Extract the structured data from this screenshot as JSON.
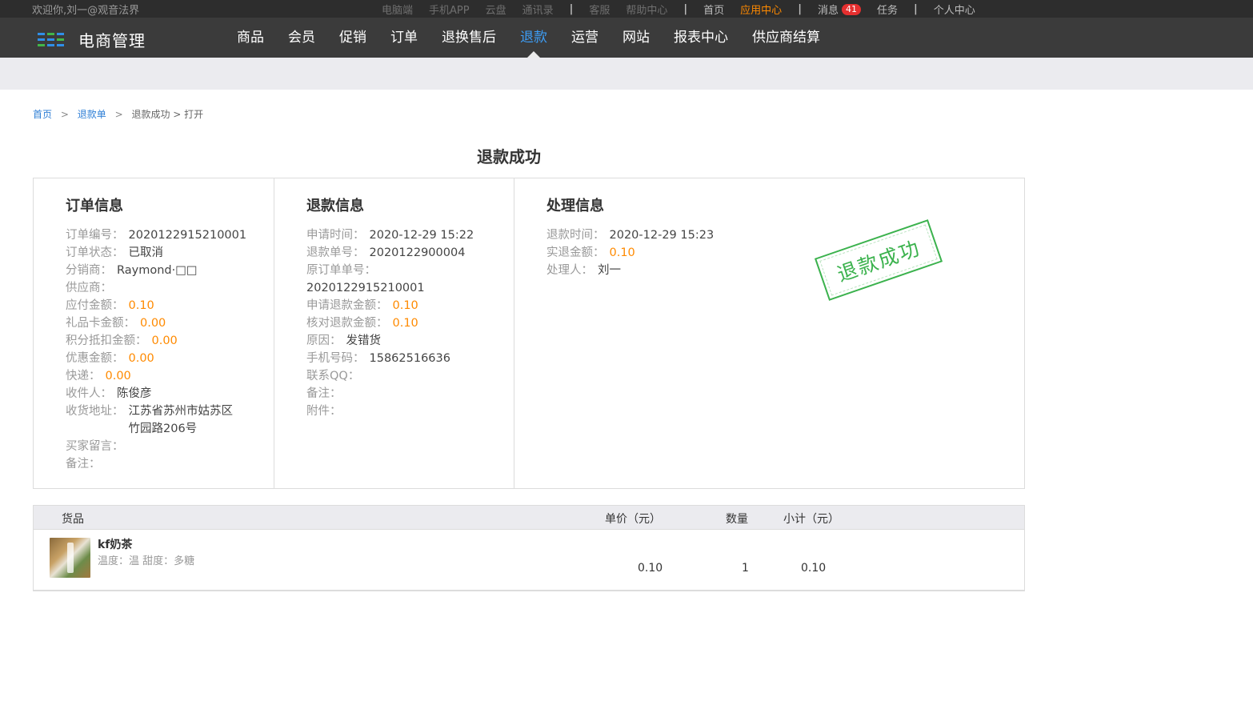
{
  "topbar": {
    "welcome": "欢迎你,刘一@观音法界",
    "links_dim": [
      "电脑端",
      "手机APP",
      "云盘",
      "通讯录"
    ],
    "links_mid": [
      "客服",
      "帮助中心"
    ],
    "separator": "|",
    "home": "首页",
    "app_center": "应用中心",
    "messages": "消息",
    "messages_count": "41",
    "tasks": "任务",
    "personal": "个人中心"
  },
  "nav": {
    "logo_text": "电商管理",
    "items": [
      "商品",
      "会员",
      "促销",
      "订单",
      "退换售后",
      "退款",
      "运营",
      "网站",
      "报表中心",
      "供应商结算"
    ],
    "active_index": 5
  },
  "breadcrumb": {
    "home": "首页",
    "refund_list": "退款单",
    "current": "退款成功 > 打开",
    "separator": ">"
  },
  "page_title": "退款成功",
  "order_info": {
    "title": "订单信息",
    "order_no_label": "订单编号：",
    "order_no": "2020122915210001",
    "status_label": "订单状态：",
    "status": "已取消",
    "distributor_label": "分销商：",
    "distributor": "Raymond·□□",
    "supplier_label": "供应商：",
    "payable_label": "应付金额：",
    "payable": "0.10",
    "giftcard_label": "礼品卡金额：",
    "giftcard": "0.00",
    "points_label": "积分抵扣金额：",
    "points": "0.00",
    "discount_label": "优惠金额：",
    "discount": "0.00",
    "express_label": "快递：",
    "express": "0.00",
    "receiver_label": "收件人：",
    "receiver": "陈俊彦",
    "address_label": "收货地址：",
    "address": "江苏省苏州市姑苏区竹园路206号",
    "buyer_msg_label": "买家留言：",
    "remark_label": "备注："
  },
  "refund_info": {
    "title": "退款信息",
    "apply_time_label": "申请时间：",
    "apply_time": "2020-12-29 15:22",
    "refund_no_label": "退款单号：",
    "refund_no": "2020122900004",
    "orig_order_label": "原订单单号：",
    "orig_order": "2020122915210001",
    "apply_amount_label": "申请退款金额：",
    "apply_amount": "0.10",
    "check_amount_label": "核对退款金额：",
    "check_amount": "0.10",
    "reason_label": "原因：",
    "reason": "发错货",
    "phone_label": "手机号码：",
    "phone": "15862516636",
    "qq_label": "联系QQ：",
    "remark_label": "备注：",
    "attachment_label": "附件："
  },
  "process_info": {
    "title": "处理信息",
    "refund_time_label": "退款时间：",
    "refund_time": "2020-12-29 15:23",
    "actual_amount_label": "实退金额：",
    "actual_amount": "0.10",
    "handler_label": "处理人：",
    "handler": "刘一",
    "stamp_text": "退款成功"
  },
  "goods": {
    "headers": {
      "item": "货品",
      "unit_price": "单价（元）",
      "qty": "数量",
      "subtotal": "小计（元）"
    },
    "rows": [
      {
        "name": "kf奶茶",
        "attrs": "温度：温   甜度：多糖",
        "unit_price": "0.10",
        "qty": "1",
        "subtotal": "0.10"
      }
    ]
  },
  "colors": {
    "accent_blue": "#3d9df5",
    "orange": "#ff8a00",
    "stamp_green": "#3bb24d",
    "badge_red": "#e52f2f"
  }
}
